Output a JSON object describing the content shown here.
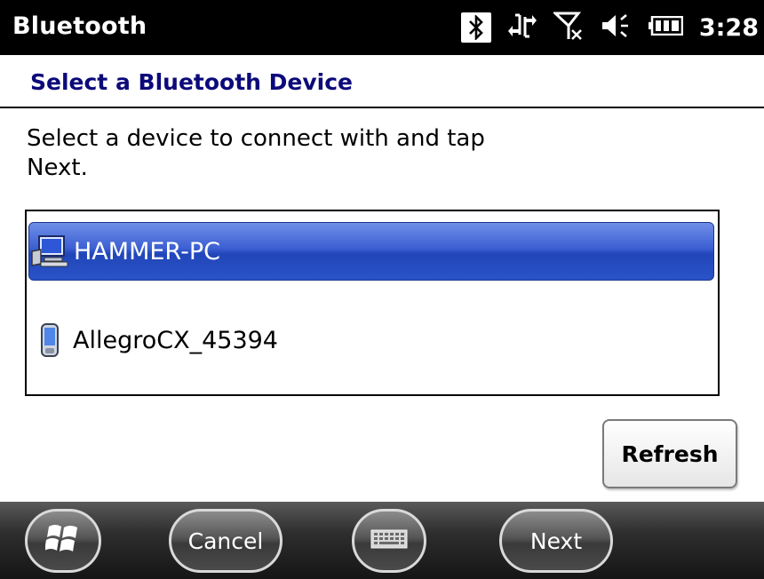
{
  "status_bar": {
    "app_title": "Bluetooth",
    "time": "3:28",
    "icons": [
      "bluetooth-icon",
      "data-connection-icon",
      "no-signal-icon",
      "speaker-icon",
      "battery-icon"
    ]
  },
  "header": {
    "title": "Select a Bluetooth Device"
  },
  "instruction": "Select a device to connect with and tap Next.",
  "devices": [
    {
      "name": "HAMMER-PC",
      "icon": "computer-icon",
      "selected": true
    },
    {
      "name": "AllegroCX_45394",
      "icon": "handheld-device-icon",
      "selected": false
    }
  ],
  "refresh_label": "Refresh",
  "softkeys": {
    "cancel": "Cancel",
    "next": "Next"
  },
  "colors": {
    "title_blue": "#0c0a7a",
    "selection_blue": "#2a53c8"
  }
}
